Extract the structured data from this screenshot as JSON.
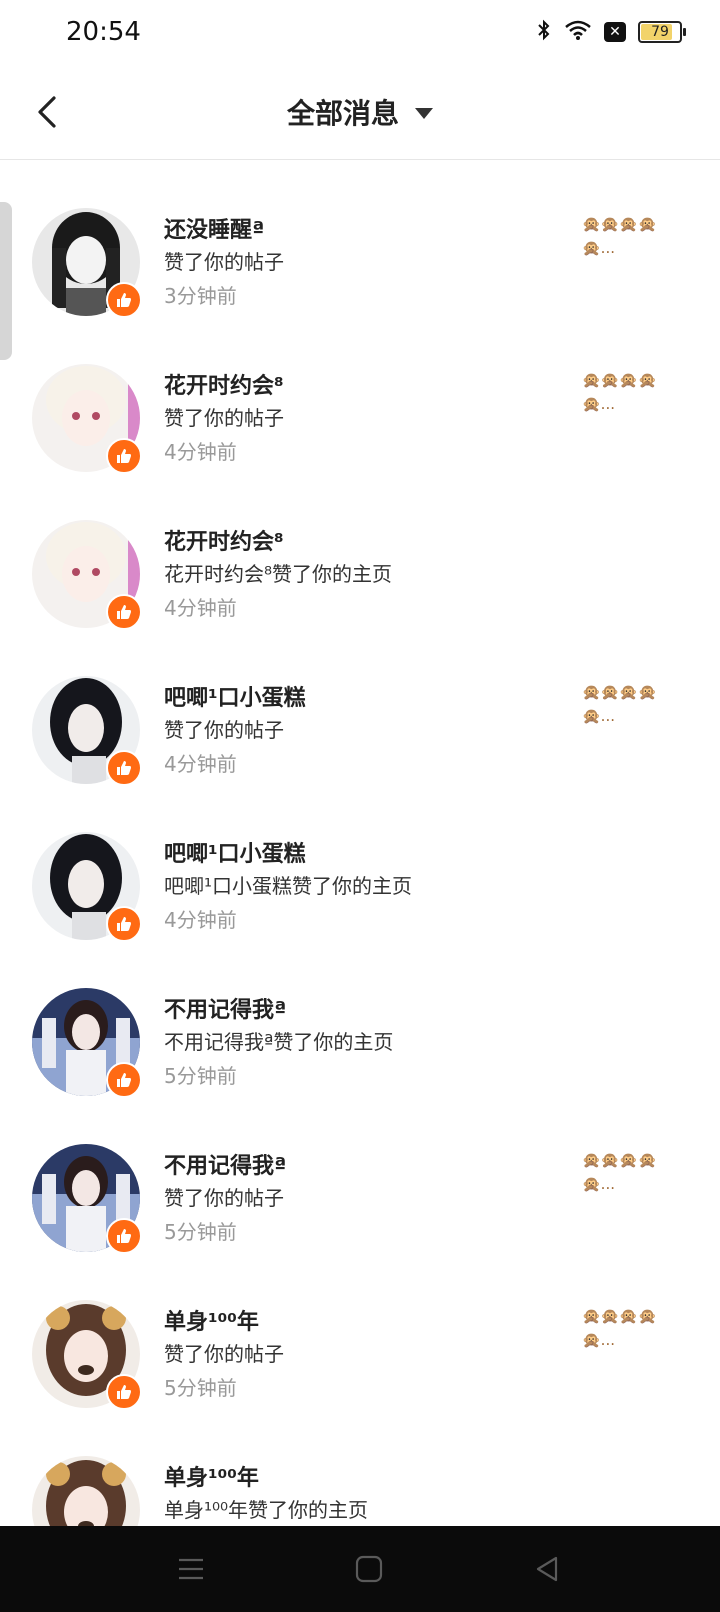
{
  "status_bar": {
    "time": "20:54",
    "battery": "79",
    "icons": [
      "bluetooth-icon",
      "wifi-icon",
      "notification-x-icon",
      "battery-icon"
    ]
  },
  "header": {
    "title": "全部消息",
    "back_icon": "chevron-left-icon",
    "dropdown_icon": "caret-down-icon"
  },
  "messages": [
    {
      "name": "还没睡醒ª",
      "action": "赞了你的帖子",
      "time": "3分钟前",
      "preview": "🙊🙊🙊🙊🙊..."
    },
    {
      "name": "花开时约会⁸",
      "action": "赞了你的帖子",
      "time": "4分钟前",
      "preview": "🙊🙊🙊🙊🙊..."
    },
    {
      "name": "花开时约会⁸",
      "action": "花开时约会⁸赞了你的主页",
      "time": "4分钟前",
      "preview": ""
    },
    {
      "name": "吧唧¹口小蛋糕",
      "action": "赞了你的帖子",
      "time": "4分钟前",
      "preview": "🙊🙊🙊🙊🙊..."
    },
    {
      "name": "吧唧¹口小蛋糕",
      "action": "吧唧¹口小蛋糕赞了你的主页",
      "time": "4分钟前",
      "preview": ""
    },
    {
      "name": "不用记得我ª",
      "action": "不用记得我ª赞了你的主页",
      "time": "5分钟前",
      "preview": ""
    },
    {
      "name": "不用记得我ª",
      "action": "赞了你的帖子",
      "time": "5分钟前",
      "preview": "🙊🙊🙊🙊🙊..."
    },
    {
      "name": "单身¹⁰⁰年",
      "action": "赞了你的帖子",
      "time": "5分钟前",
      "preview": "🙊🙊🙊🙊🙊..."
    },
    {
      "name": "单身¹⁰⁰年",
      "action": "单身¹⁰⁰年赞了你的主页",
      "time": "",
      "preview": ""
    }
  ],
  "colors": {
    "badge": "#ff6a13",
    "time_text": "#999999",
    "nav_bar": "#0b0b0b"
  },
  "navbar": {
    "icons": [
      "menu-icon",
      "home-square-icon",
      "back-triangle-icon"
    ]
  }
}
